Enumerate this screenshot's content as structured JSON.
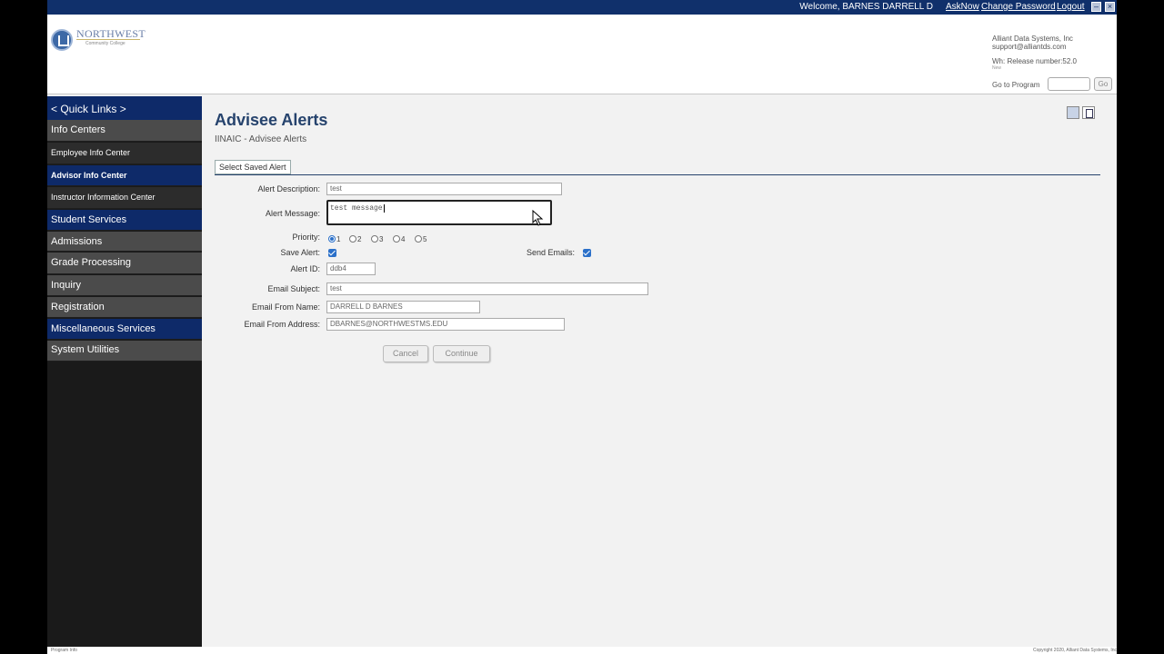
{
  "topbar": {
    "welcome": "Welcome, BARNES DARRELL D",
    "links": [
      "AskNow",
      "Change Password",
      "Logout"
    ]
  },
  "header": {
    "logo_name": "NORTHWEST",
    "logo_sub": "Community College",
    "company": "Alliant Data Systems, Inc",
    "support": "support@alliantds.com",
    "release": "Wh: Release number:52.0",
    "release_trail": "New",
    "go_to_program": "Go to Program",
    "go_button": "Go"
  },
  "sidebar": {
    "quick_links": "< Quick Links >",
    "items": [
      {
        "label": "Info Centers",
        "style": "grey",
        "size": "11px",
        "bold": false
      },
      {
        "label": "Employee Info Center",
        "style": "dark",
        "size": "9px",
        "bold": false
      },
      {
        "label": "Advisor Info Center",
        "style": "blue",
        "size": "9px",
        "bold": true
      },
      {
        "label": "Instructor Information Center",
        "style": "dark",
        "size": "9px",
        "bold": false
      },
      {
        "label": "Student Services",
        "style": "blue",
        "size": "11px",
        "bold": false
      },
      {
        "label": "Admissions",
        "style": "grey",
        "size": "11px",
        "bold": false
      },
      {
        "label": "Grade Processing",
        "style": "grey",
        "size": "11px",
        "bold": false
      },
      {
        "label": "Inquiry",
        "style": "grey",
        "size": "11px",
        "bold": false
      },
      {
        "label": "Registration",
        "style": "grey",
        "size": "11px",
        "bold": false
      },
      {
        "label": "Miscellaneous Services",
        "style": "blue",
        "size": "11px",
        "bold": false
      },
      {
        "label": "System Utilities",
        "style": "grey",
        "size": "11px",
        "bold": false
      }
    ]
  },
  "main": {
    "title": "Advisee Alerts",
    "subtitle": "IINAIC - Advisee Alerts",
    "tab": "Select Saved Alert",
    "form": {
      "alert_description_label": "Alert Description:",
      "alert_description_value": "test",
      "alert_message_label": "Alert Message:",
      "alert_message_value": "test message",
      "priority_label": "Priority:",
      "priority_options": [
        "1",
        "2",
        "3",
        "4",
        "5"
      ],
      "priority_selected": "1",
      "save_alert_label": "Save Alert:",
      "save_alert_checked": true,
      "send_emails_label": "Send Emails:",
      "send_emails_checked": true,
      "alert_id_label": "Alert ID:",
      "alert_id_value": "ddb4",
      "email_subject_label": "Email Subject:",
      "email_subject_value": "test",
      "email_from_name_label": "Email From Name:",
      "email_from_name_value": "DARRELL D BARNES",
      "email_from_address_label": "Email From Address:",
      "email_from_address_value": "DBARNES@NORTHWESTMS.EDU"
    },
    "buttons": {
      "cancel": "Cancel",
      "continue": "Continue"
    }
  },
  "footer": {
    "left": "Program Info",
    "right": "Copyright 2020, Alliant Data Systems, Inc"
  },
  "colors": {
    "nav_blue": "#0e2a69",
    "top_bar": "#10306b",
    "title": "#26436d",
    "checkbox": "#2b70c9"
  }
}
